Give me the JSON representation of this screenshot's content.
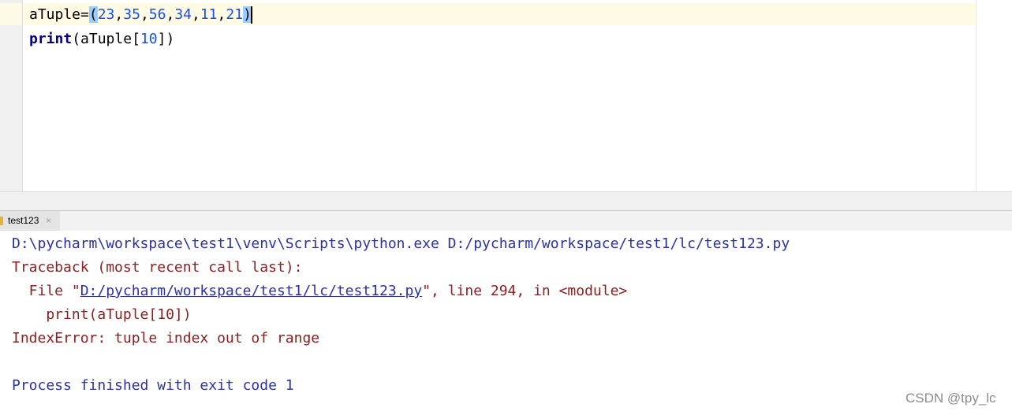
{
  "editor": {
    "line1": {
      "name": "aTuple",
      "op": "=",
      "open": "(",
      "values": [
        "23",
        "35",
        "56",
        "34",
        "11",
        "21"
      ],
      "sep": ",",
      "close": ")"
    },
    "line2": {
      "keyword": "print",
      "open": "(",
      "arg": "aTuple",
      "bracket_open": "[",
      "index": "10",
      "bracket_close": "]",
      "close": ")"
    }
  },
  "run_panel": {
    "tab_label": "test123",
    "tab_close": "×",
    "console": {
      "command": "D:\\pycharm\\workspace\\test1\\venv\\Scripts\\python.exe D:/pycharm/workspace/test1/lc/test123.py",
      "traceback": "Traceback (most recent call last):",
      "file_prefix": "  File \"",
      "file_link": "D:/pycharm/workspace/test1/lc/test123.py",
      "file_suffix": "\", line 294, in <module>",
      "code_line": "    print(aTuple[10])",
      "error": "IndexError: tuple index out of range",
      "exit": "Process finished with exit code 1"
    }
  },
  "watermark": "CSDN @tpy_lc",
  "colors": {
    "number": "#1750eb",
    "keyword": "#000080",
    "console_blue": "#2a31a7",
    "console_red": "#8a2020",
    "bracket_highlight": "#99ccff"
  }
}
